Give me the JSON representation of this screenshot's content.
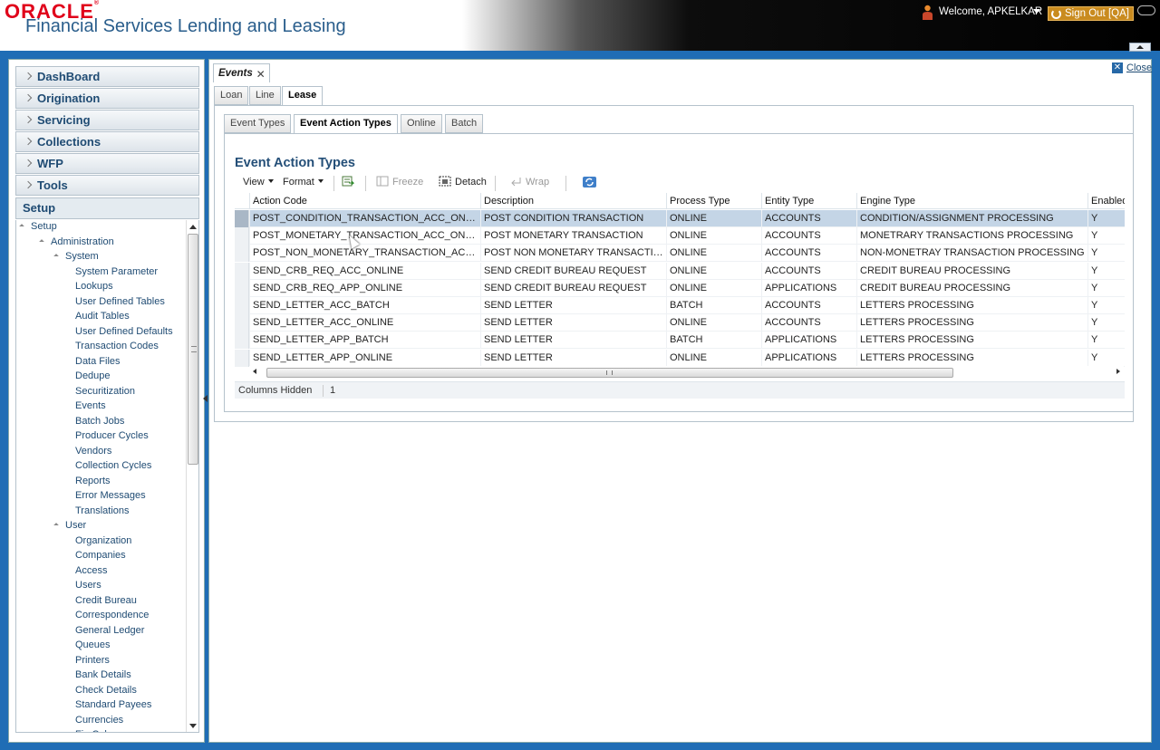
{
  "header": {
    "logo_text": "ORACLE",
    "logo_mark": "®",
    "app_title": "Financial Services Lending and Leasing",
    "welcome": "Welcome, APKELKAR",
    "signout": "Sign Out [QA]"
  },
  "nav": {
    "accordion": [
      "DashBoard",
      "Origination",
      "Servicing",
      "Collections",
      "WFP",
      "Tools"
    ],
    "active_section": "Setup",
    "tree": [
      {
        "label": "Setup",
        "level": 0,
        "expanded": true
      },
      {
        "label": "Administration",
        "level": 1,
        "expanded": true
      },
      {
        "label": "System",
        "level": 2,
        "expanded": true
      },
      {
        "label": "System Parameter",
        "level": 3
      },
      {
        "label": "Lookups",
        "level": 3
      },
      {
        "label": "User Defined Tables",
        "level": 3
      },
      {
        "label": "Audit Tables",
        "level": 3
      },
      {
        "label": "User Defined Defaults",
        "level": 3
      },
      {
        "label": "Transaction Codes",
        "level": 3
      },
      {
        "label": "Data Files",
        "level": 3
      },
      {
        "label": "Dedupe",
        "level": 3
      },
      {
        "label": "Securitization",
        "level": 3
      },
      {
        "label": "Events",
        "level": 3
      },
      {
        "label": "Batch Jobs",
        "level": 3
      },
      {
        "label": "Producer Cycles",
        "level": 3
      },
      {
        "label": "Vendors",
        "level": 3
      },
      {
        "label": "Collection Cycles",
        "level": 3
      },
      {
        "label": "Reports",
        "level": 3
      },
      {
        "label": "Error Messages",
        "level": 3
      },
      {
        "label": "Translations",
        "level": 3
      },
      {
        "label": "User",
        "level": 2,
        "expanded": true
      },
      {
        "label": "Organization",
        "level": 3
      },
      {
        "label": "Companies",
        "level": 3
      },
      {
        "label": "Access",
        "level": 3
      },
      {
        "label": "Users",
        "level": 3
      },
      {
        "label": "Credit Bureau",
        "level": 3
      },
      {
        "label": "Correspondence",
        "level": 3
      },
      {
        "label": "General Ledger",
        "level": 3
      },
      {
        "label": "Queues",
        "level": 3
      },
      {
        "label": "Printers",
        "level": 3
      },
      {
        "label": "Bank Details",
        "level": 3
      },
      {
        "label": "Check Details",
        "level": 3
      },
      {
        "label": "Standard Payees",
        "level": 3
      },
      {
        "label": "Currencies",
        "level": 3
      },
      {
        "label": "Fin Cal",
        "level": 3
      }
    ]
  },
  "main": {
    "doc_tab": "Events",
    "close_label": "Close",
    "product_tabs": [
      "Loan",
      "Line",
      "Lease"
    ],
    "product_tab_selected": 2,
    "sub_tabs": [
      "Event Types",
      "Event Action Types",
      "Online",
      "Batch"
    ],
    "sub_tab_selected": 1,
    "section_title": "Event Action Types",
    "toolbar": {
      "view": "View",
      "format": "Format",
      "freeze": "Freeze",
      "detach": "Detach",
      "wrap": "Wrap"
    },
    "table": {
      "columns": [
        "Action Code",
        "Description",
        "Process Type",
        "Entity Type",
        "Engine Type",
        "Enabled"
      ],
      "rows": [
        [
          "POST_CONDITION_TRANSACTION_ACC_ONLINE",
          "POST CONDITION TRANSACTION",
          "ONLINE",
          "ACCOUNTS",
          "CONDITION/ASSIGNMENT PROCESSING",
          "Y"
        ],
        [
          "POST_MONETARY_TRANSACTION_ACC_ONLINE",
          "POST MONETARY TRANSACTION",
          "ONLINE",
          "ACCOUNTS",
          "MONETRARY TRANSACTIONS PROCESSING",
          "Y"
        ],
        [
          "POST_NON_MONETARY_TRANSACTION_ACC_ON...",
          "POST NON MONETARY TRANSACTION",
          "ONLINE",
          "ACCOUNTS",
          "NON-MONETRAY TRANSACTION PROCESSING",
          "Y"
        ],
        [
          "SEND_CRB_REQ_ACC_ONLINE",
          "SEND CREDIT BUREAU REQUEST",
          "ONLINE",
          "ACCOUNTS",
          "CREDIT BUREAU PROCESSING",
          "Y"
        ],
        [
          "SEND_CRB_REQ_APP_ONLINE",
          "SEND CREDIT BUREAU REQUEST",
          "ONLINE",
          "APPLICATIONS",
          "CREDIT BUREAU PROCESSING",
          "Y"
        ],
        [
          "SEND_LETTER_ACC_BATCH",
          "SEND LETTER",
          "BATCH",
          "ACCOUNTS",
          "LETTERS PROCESSING",
          "Y"
        ],
        [
          "SEND_LETTER_ACC_ONLINE",
          "SEND LETTER",
          "ONLINE",
          "ACCOUNTS",
          "LETTERS PROCESSING",
          "Y"
        ],
        [
          "SEND_LETTER_APP_BATCH",
          "SEND LETTER",
          "BATCH",
          "APPLICATIONS",
          "LETTERS PROCESSING",
          "Y"
        ],
        [
          "SEND_LETTER_APP_ONLINE",
          "SEND LETTER",
          "ONLINE",
          "APPLICATIONS",
          "LETTERS PROCESSING",
          "Y"
        ]
      ],
      "selected_row": 0
    },
    "status": {
      "label": "Columns Hidden",
      "value": "1"
    }
  },
  "colors": {
    "brand_red": "#e0001a",
    "frame_blue": "#1f6db5",
    "title_blue": "#2a5e8c",
    "selected_row": "#c4d5e6"
  }
}
